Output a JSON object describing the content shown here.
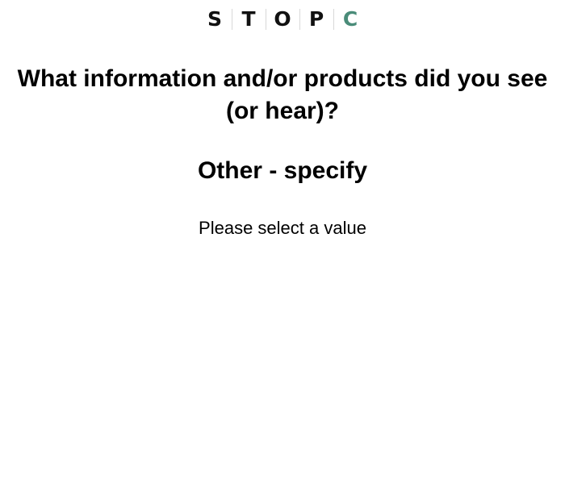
{
  "logo": {
    "letters": [
      "S",
      "T",
      "O",
      "P",
      "C"
    ],
    "accent_color": "#4a8c79"
  },
  "question": {
    "title": "What information and/or products did you see (or hear)?",
    "subtitle": "Other - specify"
  },
  "prompt": {
    "text": "Please select a value"
  }
}
